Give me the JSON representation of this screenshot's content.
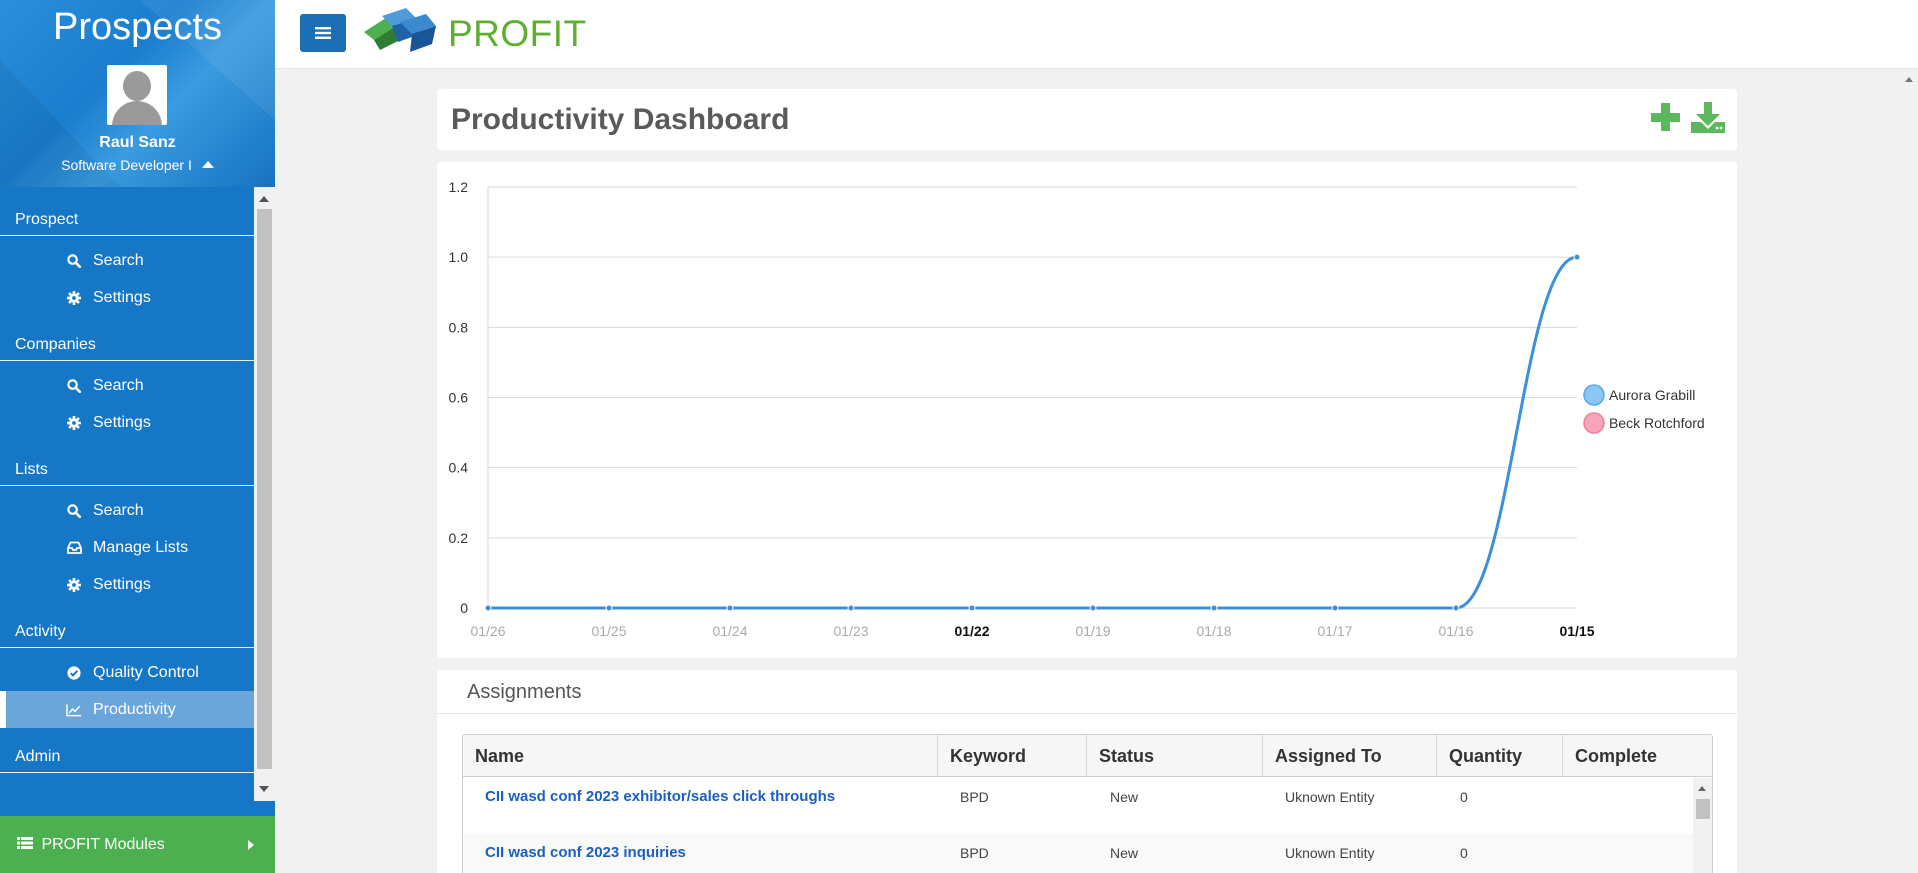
{
  "app": {
    "title": "Prospects",
    "logo_text": "PROFIT"
  },
  "user": {
    "name": "Raul Sanz",
    "role": "Software Developer I"
  },
  "nav": {
    "sections": [
      {
        "title": "Prospect",
        "items": [
          {
            "label": "Search",
            "icon": "search-icon"
          },
          {
            "label": "Settings",
            "icon": "gear-icon"
          }
        ]
      },
      {
        "title": "Companies",
        "items": [
          {
            "label": "Search",
            "icon": "search-icon"
          },
          {
            "label": "Settings",
            "icon": "gear-icon"
          }
        ]
      },
      {
        "title": "Lists",
        "items": [
          {
            "label": "Search",
            "icon": "search-icon"
          },
          {
            "label": "Manage Lists",
            "icon": "inbox-icon"
          },
          {
            "label": "Settings",
            "icon": "gear-icon"
          }
        ]
      },
      {
        "title": "Activity",
        "items": [
          {
            "label": "Quality Control",
            "icon": "check-circle-icon"
          },
          {
            "label": "Productivity",
            "icon": "line-chart-icon",
            "active": true
          }
        ]
      },
      {
        "title": "Admin",
        "items": []
      }
    ]
  },
  "modules_bar": {
    "label": "PROFIT Modules",
    "icon": "list-icon"
  },
  "page": {
    "title": "Productivity Dashboard",
    "actions": {
      "add_icon": "plus-icon",
      "download_icon": "download-icon"
    }
  },
  "colors": {
    "sidebar": "#1577c6",
    "accent_green": "#4caf50",
    "line_blue": "#3b8fdb",
    "legend_blue": "#8cc6f2",
    "legend_pink": "#f7a6b9"
  },
  "chart_data": {
    "type": "line",
    "categories": [
      "01/26",
      "01/25",
      "01/24",
      "01/23",
      "01/22",
      "01/19",
      "01/18",
      "01/17",
      "01/16",
      "01/15"
    ],
    "bold_categories": [
      "01/22",
      "01/15"
    ],
    "series": [
      {
        "name": "Aurora Grabill",
        "color": "#3b8fdb",
        "values": [
          0,
          0,
          0,
          0,
          0,
          0,
          0,
          0,
          0,
          1
        ]
      },
      {
        "name": "Beck Rotchford",
        "color": "#f7a6b9",
        "values": []
      }
    ],
    "y_ticks": [
      "0",
      "0.2",
      "0.4",
      "0.6",
      "0.8",
      "1.0",
      "1.2"
    ],
    "ylim": [
      0,
      1.2
    ],
    "grid": true,
    "legend": "right"
  },
  "assignments": {
    "title": "Assignments",
    "columns": [
      "Name",
      "Keyword",
      "Status",
      "Assigned To",
      "Quantity",
      "Complete"
    ],
    "rows": [
      {
        "name": "CII wasd conf 2023 exhibitor/sales click throughs",
        "keyword": "BPD",
        "status": "New",
        "assigned_to": "Uknown Entity",
        "quantity": "0",
        "complete": ""
      },
      {
        "name": "CII wasd conf 2023 inquiries",
        "keyword": "BPD",
        "status": "New",
        "assigned_to": "Uknown Entity",
        "quantity": "0",
        "complete": ""
      }
    ]
  }
}
